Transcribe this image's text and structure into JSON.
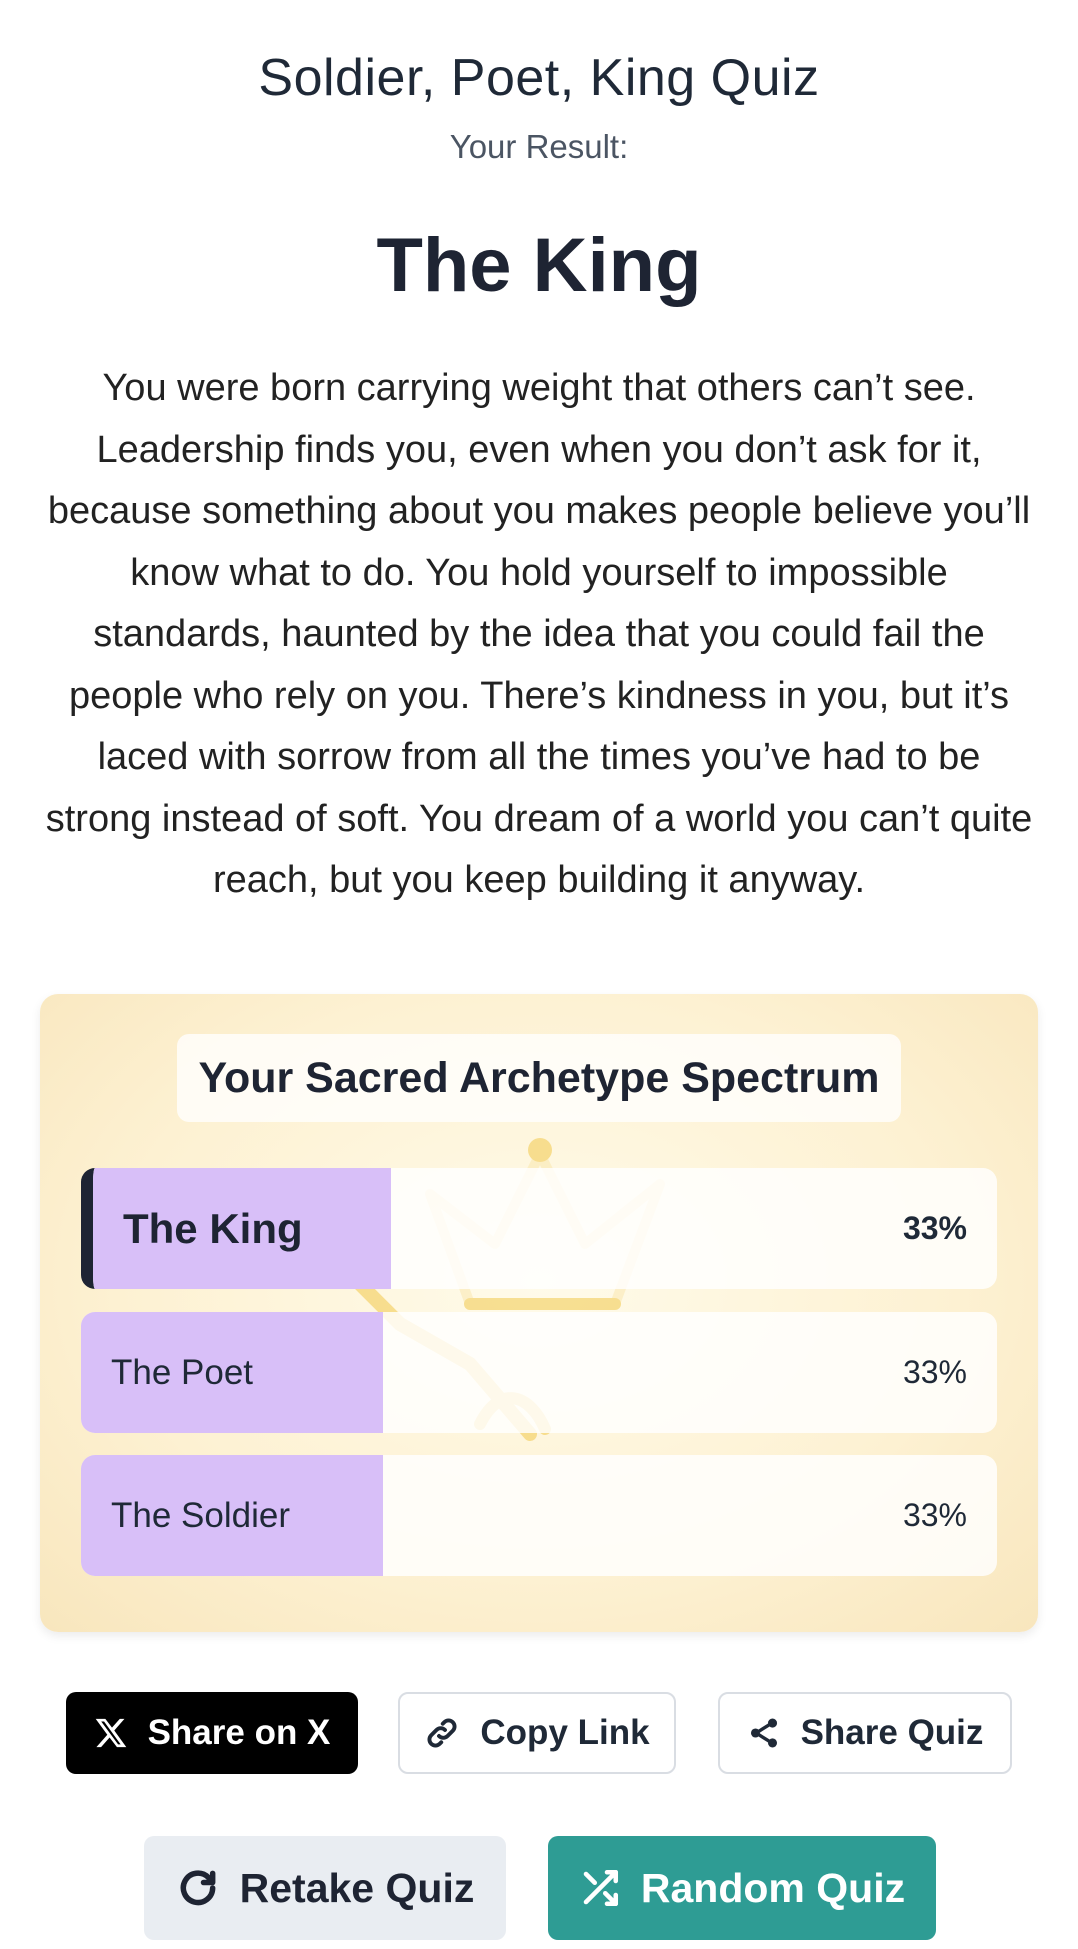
{
  "header": {
    "quiz_title": "Soldier, Poet, King Quiz",
    "result_label": "Your Result:"
  },
  "result": {
    "name": "The King",
    "description": "You were born carrying weight that others can’t see. Leadership finds you, even when you don’t ask for it, because something about you makes people believe you’ll know what to do. You hold yourself to impossible standards, haunted by the idea that you could fail the people who rely on you. There’s kindness in you, but it’s laced with sorrow from all the times you’ve had to be strong instead of soft. You dream of a world you can’t quite reach, but you keep building it anyway."
  },
  "spectrum": {
    "title": "Your Sacred Archetype Spectrum",
    "background_icons": [
      "crown-icon",
      "sword-icon"
    ],
    "bars": [
      {
        "label": "The King",
        "percent_label": "33%",
        "value": 0.33,
        "highlighted": true
      },
      {
        "label": "The Poet",
        "percent_label": "33%",
        "value": 0.33,
        "highlighted": false
      },
      {
        "label": "The Soldier",
        "percent_label": "33%",
        "value": 0.33,
        "highlighted": false
      }
    ],
    "bar_color": "#d8bff8"
  },
  "share": {
    "x_label": "Share on X",
    "copy_label": "Copy Link",
    "share_label": "Share Quiz"
  },
  "actions": {
    "retake_label": "Retake Quiz",
    "random_label": "Random Quiz"
  },
  "colors": {
    "random_button": "#2e9c94",
    "x_button": "#000000",
    "retake_button": "#e9edf2"
  }
}
